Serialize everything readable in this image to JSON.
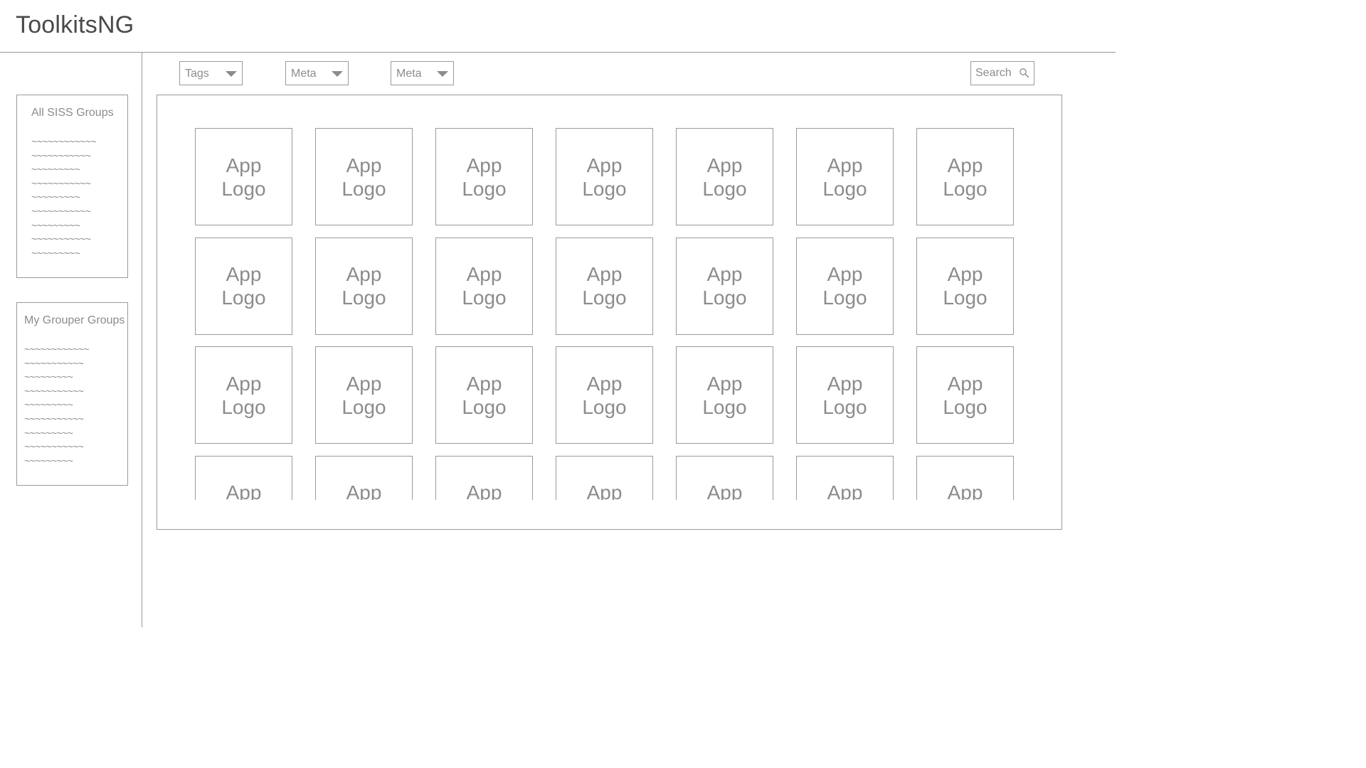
{
  "header": {
    "title": "ToolkitsNG"
  },
  "sidebar": {
    "panels": [
      {
        "title": "All SISS Groups",
        "lines": [
          "~~~~~~~~~~~~",
          "~~~~~~~~~~~",
          "~~~~~~~~~",
          "~~~~~~~~~~~",
          "~~~~~~~~~",
          "~~~~~~~~~~~",
          "~~~~~~~~~",
          "~~~~~~~~~~~",
          "~~~~~~~~~"
        ]
      },
      {
        "title": "My Grouper Groups",
        "lines": [
          "~~~~~~~~~~~~",
          "~~~~~~~~~~~",
          "~~~~~~~~~",
          "~~~~~~~~~~~",
          "~~~~~~~~~",
          "~~~~~~~~~~~",
          "~~~~~~~~~",
          "~~~~~~~~~~~",
          "~~~~~~~~~"
        ]
      }
    ]
  },
  "filters": {
    "dropdowns": [
      {
        "label": "Tags"
      },
      {
        "label": "Meta"
      },
      {
        "label": "Meta"
      }
    ],
    "search": {
      "placeholder": "Search",
      "icon": "search-icon"
    }
  },
  "grid": {
    "rows": 4,
    "columns": 7,
    "tile_line1": "App",
    "tile_line2": "Logo"
  },
  "colors": {
    "border": "#9a9a9a",
    "text": "#8c8c8c",
    "title_text": "#4a4a4a",
    "background": "#ffffff"
  }
}
